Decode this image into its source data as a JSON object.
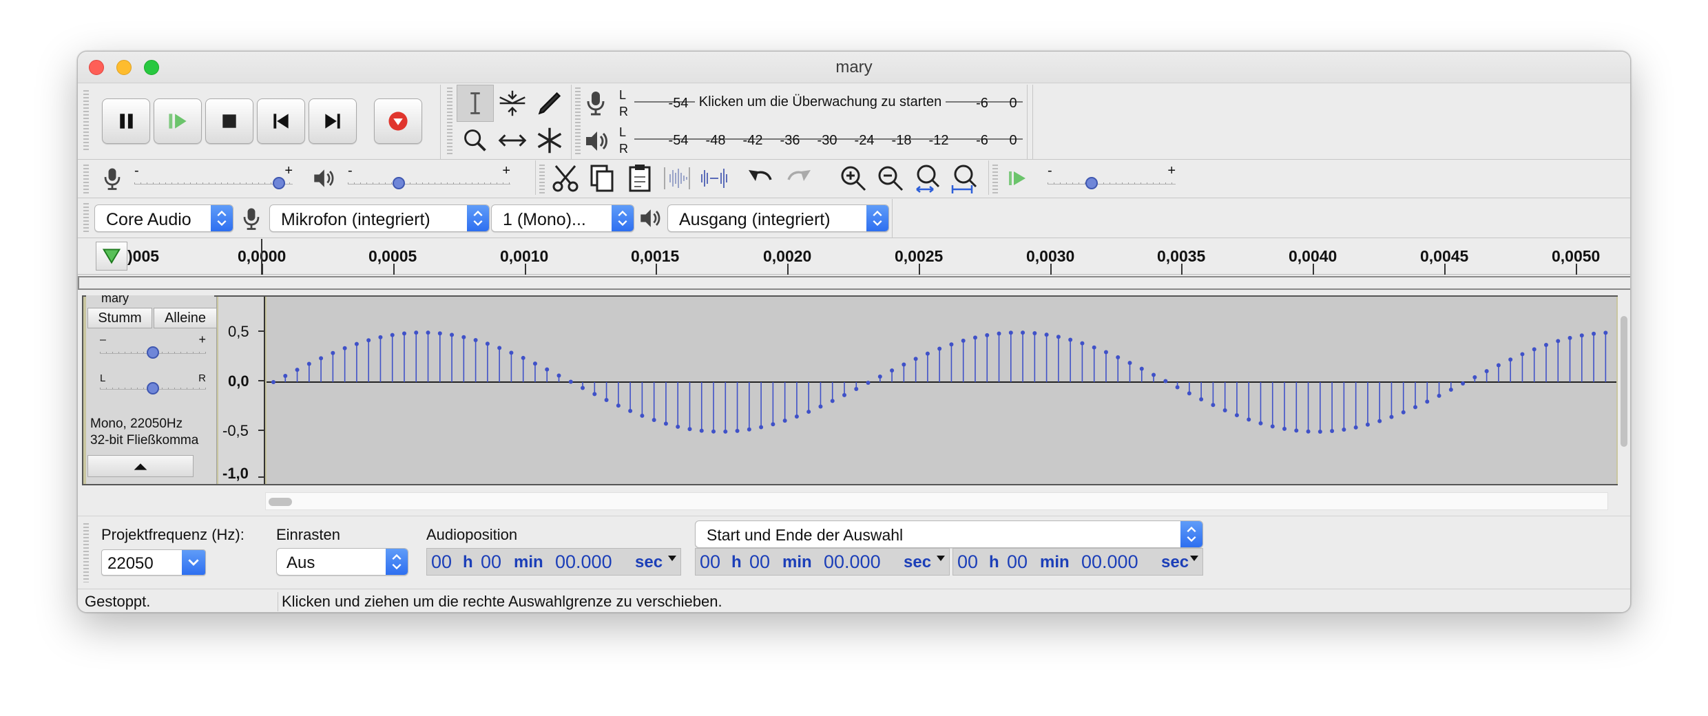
{
  "window": {
    "title": "mary"
  },
  "transport": {
    "buttons": [
      "pause",
      "play",
      "stop",
      "skip-start",
      "skip-end",
      "record"
    ]
  },
  "meters": {
    "record": {
      "l": "L",
      "r": "R",
      "tick_left": "-54",
      "hint": "Klicken um die Überwachung zu starten",
      "tick_m6": "-6",
      "tick_0": "0"
    },
    "playback": {
      "l": "L",
      "r": "R",
      "ticks": [
        "-54",
        "-48",
        "-42",
        "-36",
        "-30",
        "-24",
        "-18",
        "-12",
        "-6",
        "0"
      ]
    }
  },
  "mixer": {
    "minus": "-",
    "plus": "+",
    "record_volume": 0.95,
    "playback_volume": 0.3
  },
  "play_at_speed": {
    "minus": "-",
    "plus": "+",
    "speed": 0.33
  },
  "devices": {
    "host": "Core Audio",
    "input": "Mikrofon (integriert)",
    "channels": "1 (Mono)...",
    "output": "Ausgang (integriert)"
  },
  "ruler": {
    "labels": [
      ")005",
      "0,0000",
      "0,0005",
      "0,0010",
      "0,0015",
      "0,0020",
      "0,0025",
      "0,0030",
      "0,0035",
      "0,0040",
      "0,0045",
      "0,0050"
    ]
  },
  "track": {
    "name": "mary",
    "mute": "Stumm",
    "solo": "Alleine",
    "gain_minus": "–",
    "gain_plus": "+",
    "pan_left": "L",
    "pan_right": "R",
    "format_line1": "Mono, 22050Hz",
    "format_line2": "32-bit Fließkomma",
    "scale": [
      "0,5",
      "0,0",
      "-0,5",
      "-1,0"
    ],
    "gain": 0.5,
    "pan": 0.5,
    "sample_rate_hz": 22050,
    "frequency_hz": 440,
    "view_start_s": 0,
    "view_end_s": 0.00511
  },
  "bottom": {
    "rate_label": "Projektfrequenz (Hz):",
    "rate_value": "22050",
    "snap_label": "Einrasten",
    "snap_value": "Aus",
    "pos_label": "Audioposition",
    "sel_mode": "Start und Ende der Auswahl",
    "time": {
      "h": "00",
      "hu": "h",
      "m": "00",
      "mu": "min",
      "s": "00.000",
      "su": "sec"
    }
  },
  "status": {
    "state": "Gestoppt.",
    "message": "Klicken und ziehen um die rechte Auswahlgrenze zu verschieben."
  },
  "colors": {
    "waveform": "#3f51c8",
    "track_bg": "#c9c9c9",
    "accent": "#2e6ff0"
  }
}
